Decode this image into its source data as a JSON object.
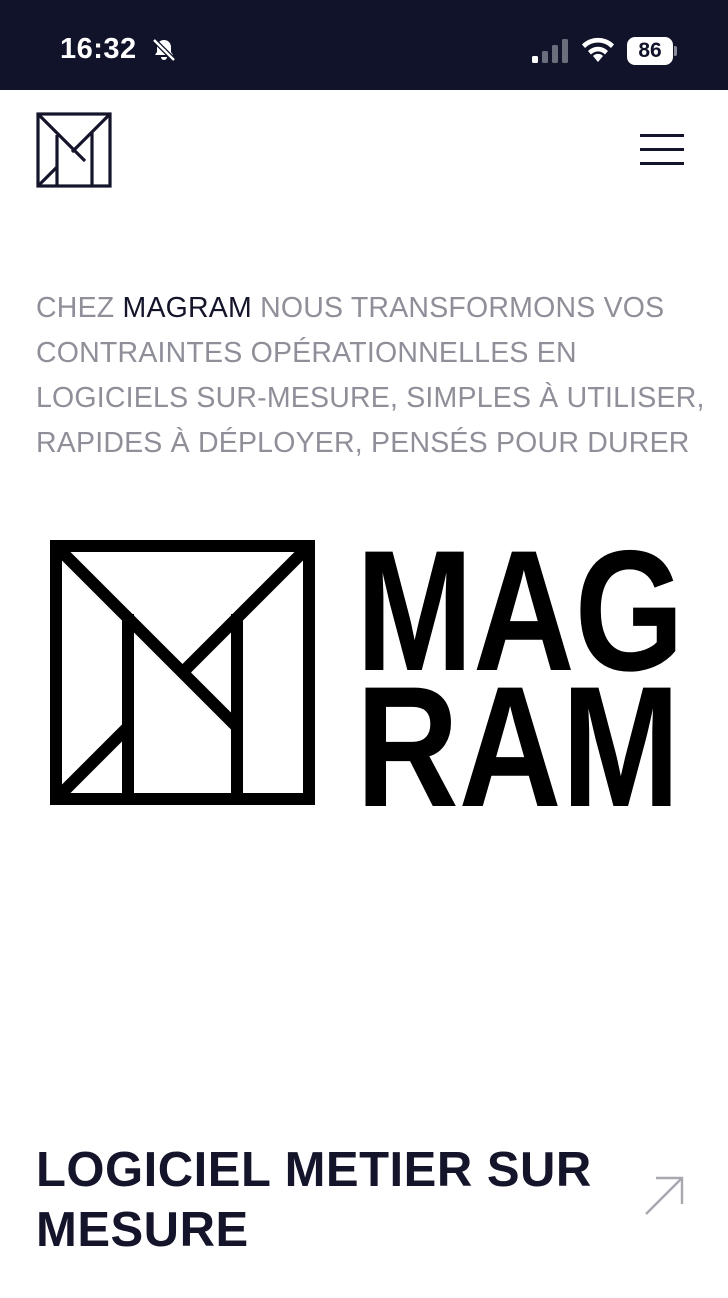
{
  "status_bar": {
    "time": "16:32",
    "battery_level": "86",
    "icons": [
      "bell-slash-icon",
      "cellular-signal-icon",
      "wifi-icon",
      "battery-icon"
    ]
  },
  "header": {
    "logo_icon": "magram-monogram-icon",
    "menu_icon": "hamburger-menu-icon"
  },
  "intro": {
    "prefix": "CHEZ ",
    "brand": "MAGRAM",
    "text": " NOUS TRANSFORMONS VOS CONTRAINTES OPÉRATIONNELLES EN LOGICIELS SUR-MESURE, SIMPLES À UTILISER, RAPIDES À DÉPLOYER, PENSÉS POUR DURER"
  },
  "hero_logo": {
    "line1": "MAG",
    "line2": "RAM"
  },
  "service": {
    "title": "LOGICIEL METIER SUR MESURE",
    "arrow_icon": "arrow-up-right-icon"
  },
  "colors": {
    "status_bar_bg": "#10132a",
    "text_dark": "#14142a",
    "text_muted": "#8f8f99",
    "background": "#ffffff"
  }
}
